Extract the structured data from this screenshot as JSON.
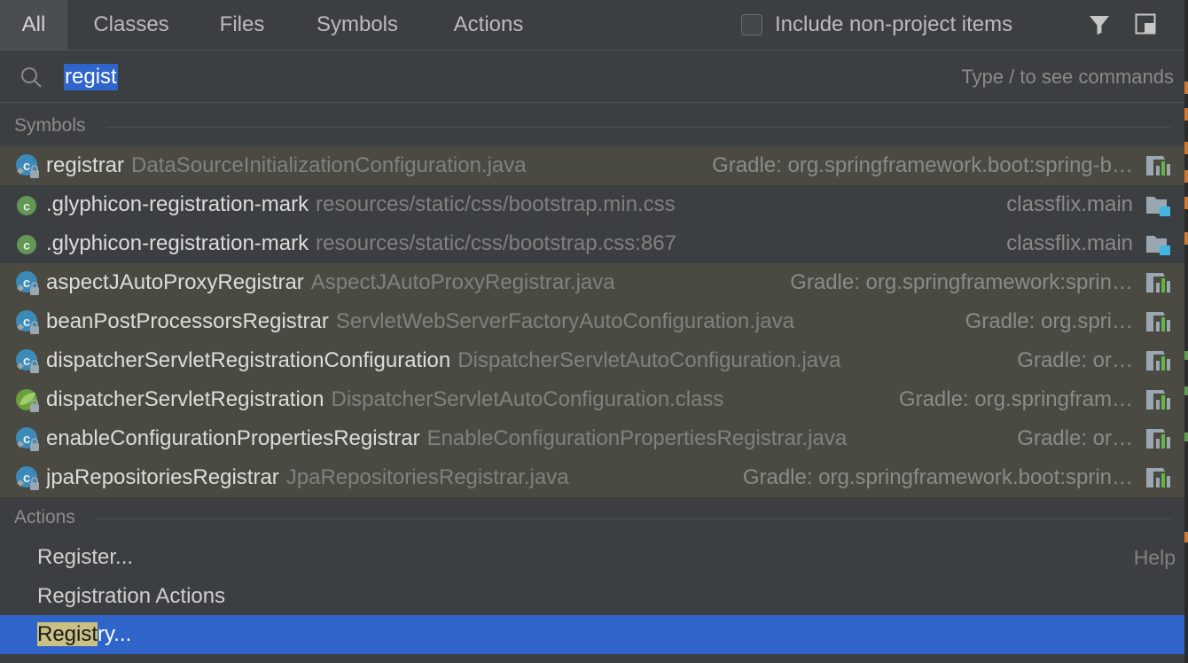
{
  "tabs": [
    {
      "label": "All",
      "active": true
    },
    {
      "label": "Classes",
      "active": false
    },
    {
      "label": "Files",
      "active": false
    },
    {
      "label": "Symbols",
      "active": false
    },
    {
      "label": "Actions",
      "active": false
    }
  ],
  "include_non_project": {
    "label": "Include non-project items",
    "checked": false
  },
  "search": {
    "value": "regist",
    "hint": "Type / to see commands"
  },
  "sections": {
    "symbols": "Symbols",
    "actions": "Actions"
  },
  "symbols": [
    {
      "name": "registrar",
      "file": "DataSourceInitializationConfiguration.java",
      "location": "Gradle: org.springframework.boot:spring-b…",
      "scope": "library",
      "icon": "class-locked-icon"
    },
    {
      "name": ".glyphicon-registration-mark",
      "file": "resources/static/css/bootstrap.min.css",
      "location": "classflix.main",
      "scope": "project",
      "icon": "css-class-icon"
    },
    {
      "name": ".glyphicon-registration-mark",
      "file": "resources/static/css/bootstrap.css:867",
      "location": "classflix.main",
      "scope": "project",
      "icon": "css-class-icon"
    },
    {
      "name": "aspectJAutoProxyRegistrar",
      "file": "AspectJAutoProxyRegistrar.java",
      "location": "Gradle: org.springframework:sprin…",
      "scope": "library",
      "icon": "class-locked-icon"
    },
    {
      "name": "beanPostProcessorsRegistrar",
      "file": "ServletWebServerFactoryAutoConfiguration.java",
      "location": "Gradle: org.spri…",
      "scope": "library",
      "icon": "class-locked-icon"
    },
    {
      "name": "dispatcherServletRegistrationConfiguration",
      "file": "DispatcherServletAutoConfiguration.java",
      "location": "Gradle: or…",
      "scope": "library",
      "icon": "class-locked-icon"
    },
    {
      "name": "dispatcherServletRegistration",
      "file": "DispatcherServletAutoConfiguration.class",
      "location": "Gradle: org.springfram…",
      "scope": "library",
      "icon": "spring-bean-icon"
    },
    {
      "name": "enableConfigurationPropertiesRegistrar",
      "file": "EnableConfigurationPropertiesRegistrar.java",
      "location": "Gradle: or…",
      "scope": "library",
      "icon": "class-locked-icon"
    },
    {
      "name": "jpaRepositoriesRegistrar",
      "file": "JpaRepositoriesRegistrar.java",
      "location": "Gradle: org.springframework.boot:sprin…",
      "scope": "library",
      "icon": "class-locked-icon"
    }
  ],
  "actions": [
    {
      "label": "Register...",
      "hint": "Help",
      "selected": false
    },
    {
      "label": "Registration Actions",
      "hint": "",
      "selected": false
    },
    {
      "label_match": "Regist",
      "label_rest": "ry...",
      "hint": "",
      "selected": true
    }
  ],
  "colors": {
    "background": "#3c3f41",
    "library_row": "#4b4a42",
    "selection": "#2f65ca",
    "match_highlight": "#c9c084"
  }
}
